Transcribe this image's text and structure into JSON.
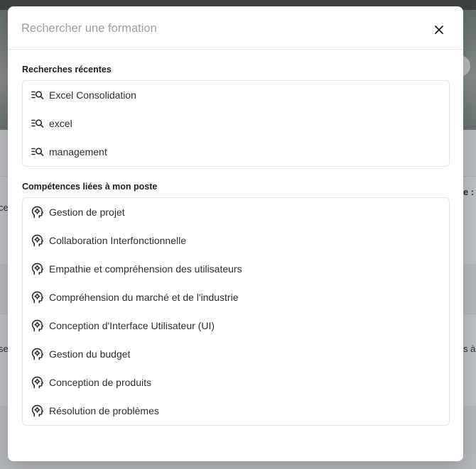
{
  "search": {
    "placeholder": "Rechercher une formation"
  },
  "recent": {
    "title": "Recherches récentes",
    "items": [
      {
        "label": "Excel Consolidation",
        "icon": "search-list-icon"
      },
      {
        "label": "excel",
        "icon": "search-list-icon"
      },
      {
        "label": "management",
        "icon": "search-list-icon"
      }
    ]
  },
  "skills": {
    "title": "Compétences liées à mon poste",
    "items": [
      {
        "label": "Gestion de projet",
        "icon": "head-gear-icon"
      },
      {
        "label": "Collaboration Interfonctionnelle",
        "icon": "head-gear-icon"
      },
      {
        "label": "Empathie et compréhension des utilisateurs",
        "icon": "head-gear-icon"
      },
      {
        "label": "Compréhension du marché et de l'industrie",
        "icon": "head-gear-icon"
      },
      {
        "label": "Conception d'Interface Utilisateur (UI)",
        "icon": "head-gear-icon"
      },
      {
        "label": "Gestion du budget",
        "icon": "head-gear-icon"
      },
      {
        "label": "Conception de produits",
        "icon": "head-gear-icon"
      },
      {
        "label": "Résolution de problèmes",
        "icon": "head-gear-icon"
      }
    ]
  },
  "background": {
    "left_fragments": [
      "ce",
      "se"
    ],
    "right_fragments": [
      "e : p",
      "s à c"
    ]
  },
  "colors": {
    "text": "#2b2d33",
    "placeholder": "#9a9ca3",
    "border": "#e6e7ea",
    "overlay": "rgba(60,64,70,0.32)"
  }
}
